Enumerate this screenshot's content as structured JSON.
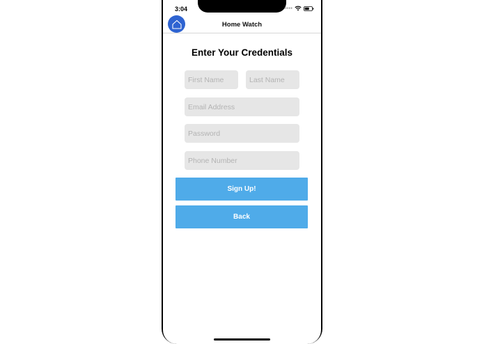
{
  "status_bar": {
    "time": "3:04"
  },
  "nav": {
    "title": "Home Watch",
    "logo_icon": "house-icon"
  },
  "form": {
    "heading": "Enter Your Credentials",
    "first_name_placeholder": "First Name",
    "last_name_placeholder": "Last Name",
    "email_placeholder": "Email Address",
    "password_placeholder": "Password",
    "phone_placeholder": "Phone Number"
  },
  "buttons": {
    "sign_up_label": "Sign Up!",
    "back_label": "Back"
  },
  "colors": {
    "accent_button": "#4fabe9",
    "logo_blue": "#2e63d1",
    "field_background": "#e6e6e6"
  }
}
